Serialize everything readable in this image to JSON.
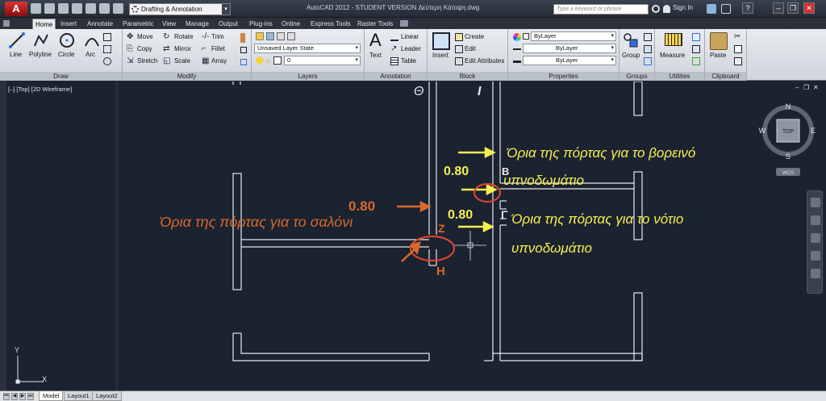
{
  "titlebar": {
    "app_button": "A",
    "workspace": "Drafting & Annotation",
    "title": "AutoCAD 2012 - STUDENT VERSION    Δεύτερη Κάτοψη.dwg",
    "search_placeholder": "Type a keyword or phrase",
    "sign_in": "Sign In",
    "help": "?",
    "min": "–",
    "max": "❐",
    "close": "✕"
  },
  "ribbon_tabs": [
    "Home",
    "Insert",
    "Annotate",
    "Parametric",
    "View",
    "Manage",
    "Output",
    "Plug-ins",
    "Online",
    "Express Tools",
    "Raster Tools"
  ],
  "panels": {
    "draw": {
      "title": "Draw",
      "line": "Line",
      "polyline": "Polyline",
      "circle": "Circle",
      "arc": "Arc"
    },
    "modify": {
      "title": "Modify",
      "move": "Move",
      "rotate": "Rotate",
      "trim": "Trim",
      "copy": "Copy",
      "mirror": "Mirror",
      "fillet": "Fillet",
      "stretch": "Stretch",
      "scale": "Scale",
      "array": "Array"
    },
    "layers": {
      "title": "Layers",
      "layer_state": "Unsaved Layer State",
      "current_layer": "0"
    },
    "annotation": {
      "title": "Annotation",
      "text": "Text",
      "linear": "Linear",
      "leader": "Leader",
      "table": "Table"
    },
    "block": {
      "title": "Block",
      "insert": "Insert",
      "create": "Create",
      "edit": "Edit",
      "edit_attributes": "Edit Attributes"
    },
    "properties": {
      "title": "Properties",
      "color": "ByLayer",
      "linetype": "ByLayer",
      "lineweight": "ByLayer"
    },
    "groups": {
      "title": "Groups",
      "group": "Group"
    },
    "utilities": {
      "title": "Utilities",
      "measure": "Measure"
    },
    "clipboard": {
      "title": "Clipboard",
      "paste": "Paste"
    }
  },
  "viewport": {
    "label": "[–] [Top] [2D Wireframe]",
    "compass": {
      "n": "N",
      "s": "S",
      "e": "E",
      "w": "W",
      "top": "TOP",
      "wcs": "WCS"
    },
    "ucs_y": "Y",
    "ucs_x": "X"
  },
  "annotations": {
    "theta": "Θ",
    "iota": "Ι",
    "north_room": "Όρια της πόρτας για το βορεινό υπνοδωμάτιο",
    "north_room_line1": "Όρια της πόρτας για το βορεινό",
    "north_room_line2": "υπνοδωμάτιο",
    "dim_beta": "0.80",
    "beta": "B",
    "dim_living": "0.80",
    "living_room": "Όρια της πόρτας για το σαλόνι",
    "dim_gamma": "0.80",
    "gamma": "Γ",
    "south_room_line1": "Όρια της πόρτας για το νότιο",
    "south_room_line2": "υπνοδωμάτιο",
    "zeta": "Z",
    "eta": "H"
  },
  "colors": {
    "yellow_text": "#f4f050",
    "orange_text": "#d96a2a",
    "circle_red": "#d9452e",
    "wall": "#e8e8e8"
  },
  "layout_tabs": [
    "Model",
    "Layout1",
    "Layout2"
  ]
}
